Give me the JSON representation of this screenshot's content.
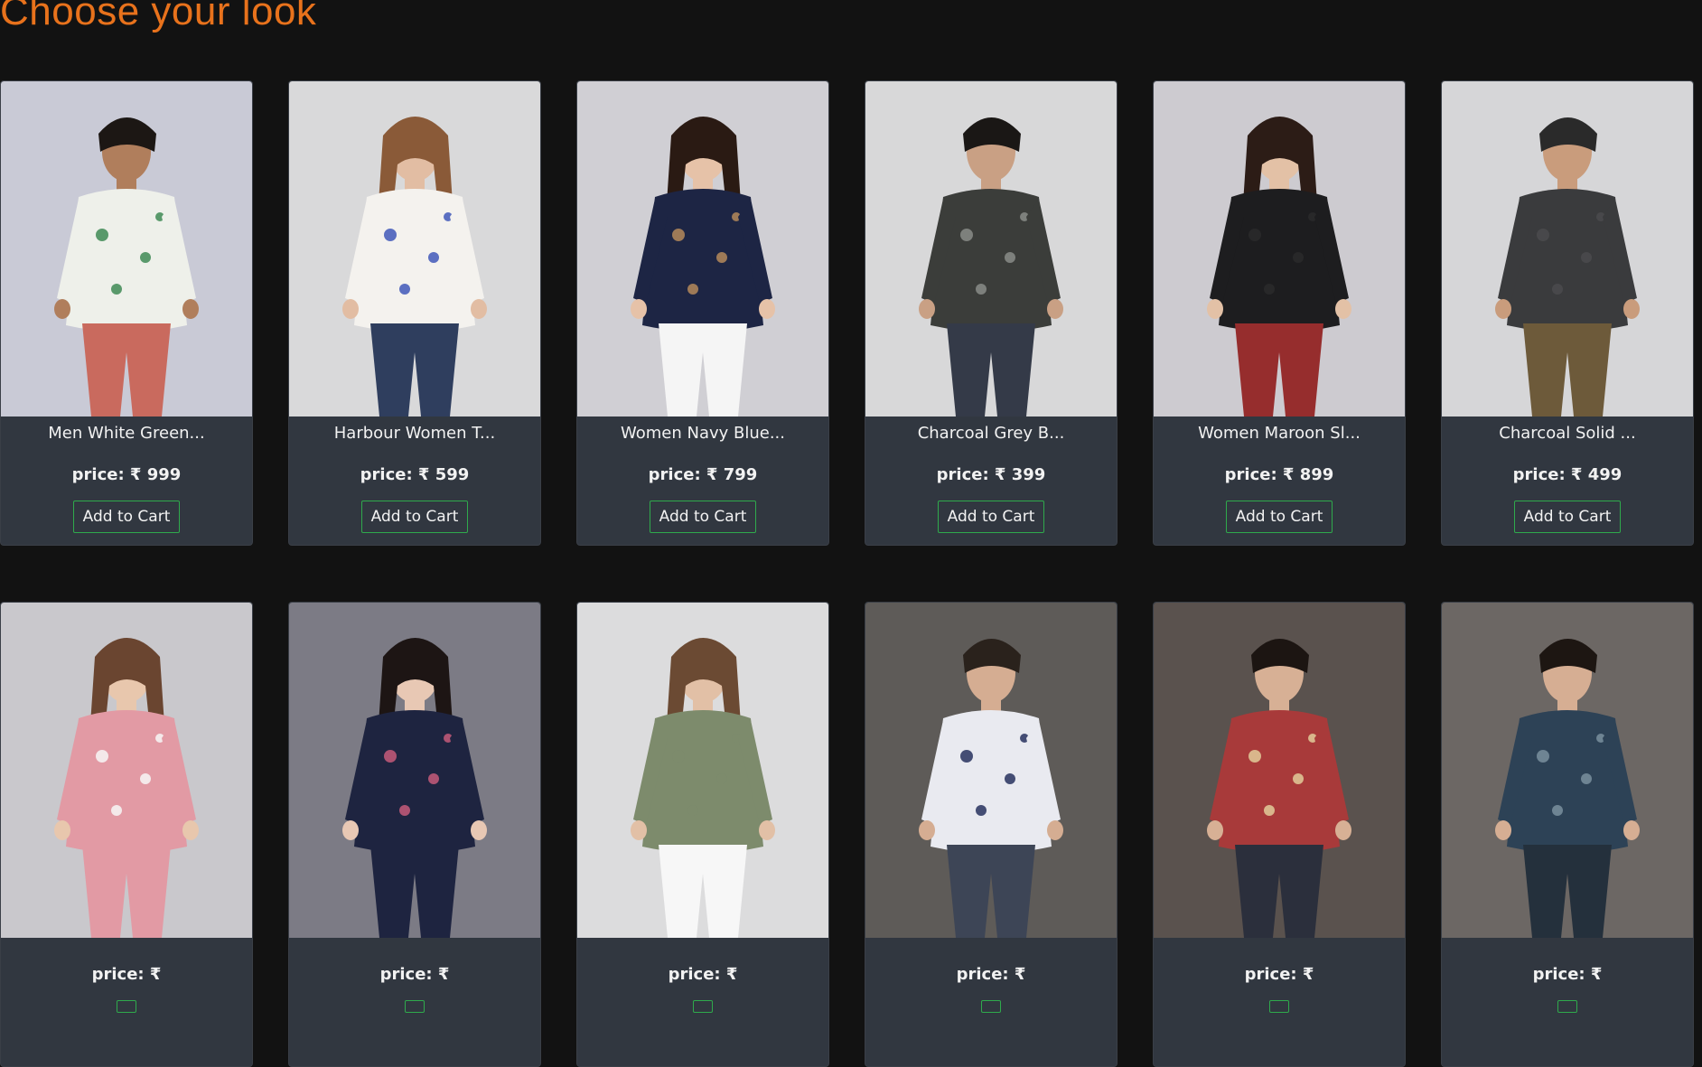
{
  "page": {
    "title": "Choose your look"
  },
  "price_prefix": "price: ₹",
  "products": [
    {
      "name": "Men White Green...",
      "price": "999",
      "button": "Add to Cart",
      "bg": "#c9cad6",
      "skin": "#b07e5c",
      "hair": "#1c1714",
      "top": "#eef0ea",
      "pattern": "#3e8a55",
      "bottom": "#c96a5e",
      "figure": "male"
    },
    {
      "name": "Harbour Women T...",
      "price": "599",
      "button": "Add to Cart",
      "bg": "#d9d9da",
      "skin": "#e2bda3",
      "hair": "#8a5a38",
      "top": "#f4f2ee",
      "pattern": "#3f58b8",
      "bottom": "#2f3e5e",
      "figure": "female"
    },
    {
      "name": "Women Navy Blue...",
      "price": "799",
      "button": "Add to Cart",
      "bg": "#d0cfd4",
      "skin": "#e6c2a8",
      "hair": "#2a1a13",
      "top": "#1d2544",
      "pattern": "#b58a5a",
      "bottom": "#f5f5f5",
      "figure": "female"
    },
    {
      "name": "Charcoal Grey B...",
      "price": "399",
      "button": "Add to Cart",
      "bg": "#d8d8d9",
      "skin": "#c9a084",
      "hair": "#1a1715",
      "top": "#3b3d3a",
      "pattern": "#8a8c88",
      "bottom": "#343a48",
      "figure": "male"
    },
    {
      "name": "Women Maroon Sl...",
      "price": "899",
      "button": "Add to Cart",
      "bg": "#cdcbd0",
      "skin": "#e3c1a6",
      "hair": "#2c1c16",
      "top": "#1d1d1f",
      "pattern": "#2a2a2c",
      "bottom": "#962d2d",
      "figure": "female"
    },
    {
      "name": "Charcoal Solid ...",
      "price": "499",
      "button": "Add to Cart",
      "bg": "#d6d6d8",
      "skin": "#c99c7c",
      "hair": "#2a2a2a",
      "top": "#3a3b3d",
      "pattern": "#4b4b4d",
      "bottom": "#6d5a3a",
      "figure": "male"
    },
    {
      "name": "",
      "price": "",
      "button": "",
      "bg": "#c9c8cc",
      "skin": "#e8c7ad",
      "hair": "#6a4530",
      "top": "#e29aa4",
      "pattern": "#f7f7f7",
      "bottom": "#e29aa4",
      "figure": "female"
    },
    {
      "name": "",
      "price": "",
      "button": "",
      "bg": "#7c7b85",
      "skin": "#e8c8b4",
      "hair": "#1d1514",
      "top": "#1e2440",
      "pattern": "#c65a7a",
      "bottom": "#1e2440",
      "figure": "female"
    },
    {
      "name": "",
      "price": "",
      "button": "",
      "bg": "#dcdcdd",
      "skin": "#e2c0a6",
      "hair": "#6b4a33",
      "top": "#7d8b6c",
      "pattern": "#7d8b6c",
      "bottom": "#f7f7f7",
      "figure": "female"
    },
    {
      "name": "",
      "price": "",
      "button": "",
      "bg": "#5e5b58",
      "skin": "#d5ad92",
      "hair": "#2a221c",
      "top": "#e9eaf0",
      "pattern": "#27315e",
      "bottom": "#3d4556",
      "figure": "male"
    },
    {
      "name": "",
      "price": "",
      "button": "",
      "bg": "#5a524e",
      "skin": "#d7b095",
      "hair": "#1c1512",
      "top": "#a83a3a",
      "pattern": "#e2cc9a",
      "bottom": "#2b2f3c",
      "figure": "male"
    },
    {
      "name": "",
      "price": "",
      "button": "",
      "bg": "#6c6764",
      "skin": "#d6ae93",
      "hair": "#1d1612",
      "top": "#2d4256",
      "pattern": "#7a8f9d",
      "bottom": "#24303c",
      "figure": "male"
    }
  ]
}
